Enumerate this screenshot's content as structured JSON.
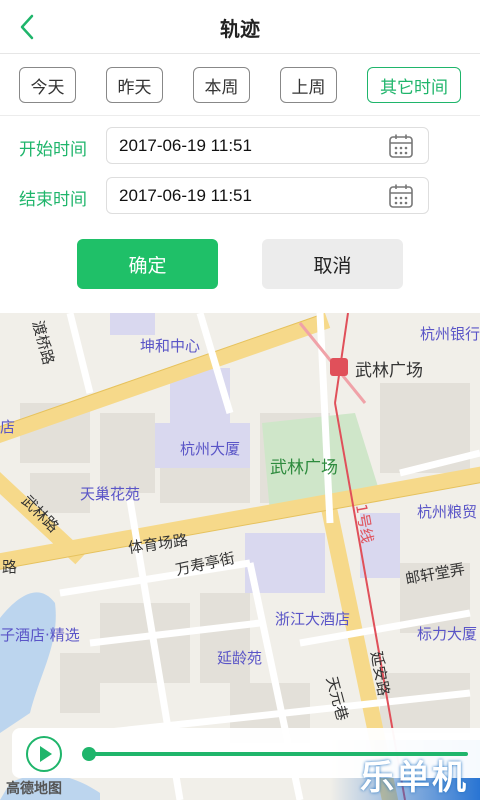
{
  "header": {
    "title": "轨迹"
  },
  "tabs": [
    {
      "label": "今天"
    },
    {
      "label": "昨天"
    },
    {
      "label": "本周"
    },
    {
      "label": "上周"
    },
    {
      "label": "其它时间",
      "active": true
    }
  ],
  "time": {
    "start_label": "开始时间",
    "start_value": "2017-06-19 11:51",
    "end_label": "结束时间",
    "end_value": "2017-06-19 11:51"
  },
  "actions": {
    "confirm": "确定",
    "cancel": "取消"
  },
  "map": {
    "pois": [
      "坤和中心",
      "杭州银行",
      "杭州大厦",
      "天巢花苑",
      "杭州粮贸",
      "浙江大酒店",
      "标力大厦",
      "延龄苑"
    ],
    "green_area": "武林广场",
    "metro_station": "武林广场",
    "streets": [
      "渡桥路",
      "武林路",
      "体育场路",
      "万寿亭街",
      "1号线",
      "邮轩堂弄",
      "延安路",
      "天元巷",
      "店",
      "路",
      "子酒店·精选"
    ],
    "logo": "高德地图"
  },
  "player": {
    "progress": 0.0
  },
  "watermark": "乐单机",
  "colors": {
    "accent": "#1fb56b",
    "poi": "#5a55c7",
    "metro_line": "#e0505a"
  }
}
